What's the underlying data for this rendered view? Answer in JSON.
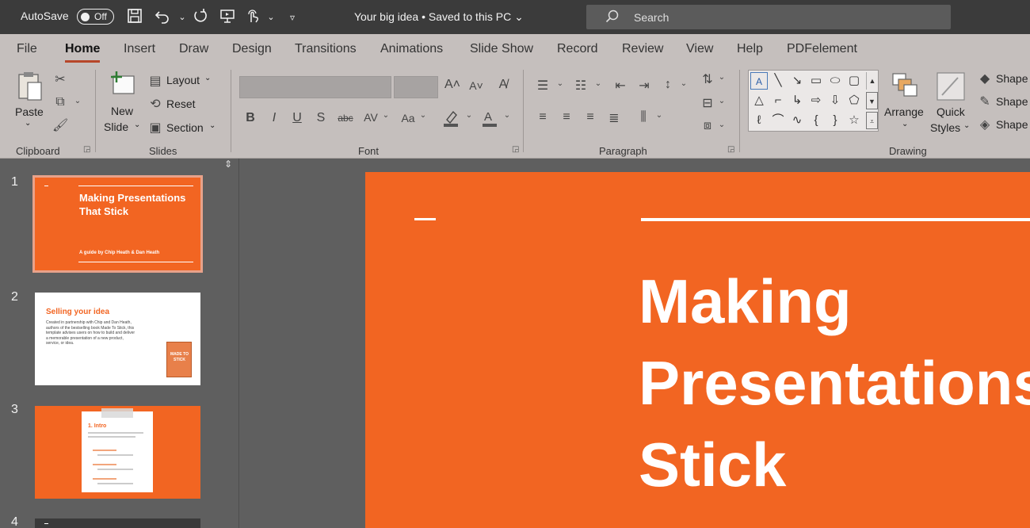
{
  "titlebar": {
    "autosave_label": "AutoSave",
    "autosave_state": "Off",
    "doc_title": "Your big idea • Saved to this PC",
    "search_placeholder": "Search",
    "icons": [
      "save-icon",
      "undo-icon",
      "redo-icon",
      "present-icon",
      "touch-mode-icon",
      "customize-toolbar-icon"
    ]
  },
  "tabs": [
    {
      "label": "File"
    },
    {
      "label": "Home",
      "active": true
    },
    {
      "label": "Insert"
    },
    {
      "label": "Draw"
    },
    {
      "label": "Design"
    },
    {
      "label": "Transitions"
    },
    {
      "label": "Animations"
    },
    {
      "label": "Slide Show"
    },
    {
      "label": "Record"
    },
    {
      "label": "Review"
    },
    {
      "label": "View"
    },
    {
      "label": "Help"
    },
    {
      "label": "PDFelement"
    }
  ],
  "ribbon": {
    "clipboard": {
      "paste": "Paste",
      "group": "Clipboard"
    },
    "slides": {
      "new_slide_1": "New",
      "new_slide_2": "Slide",
      "layout": "Layout",
      "reset": "Reset",
      "section": "Section",
      "group": "Slides"
    },
    "font": {
      "group": "Font",
      "bold": "B",
      "italic": "I",
      "underline": "U",
      "shadow": "S",
      "strike": "abc",
      "spacing": "AV",
      "case": "Aa"
    },
    "paragraph": {
      "group": "Paragraph"
    },
    "drawing": {
      "arrange": "Arrange",
      "quick_styles_1": "Quick",
      "quick_styles_2": "Styles",
      "shape_fill": "Shape",
      "shape_outline": "Shape",
      "shape_effects": "Shape",
      "group": "Drawing"
    }
  },
  "thumbnails": [
    {
      "number": "1",
      "title": "Making Presentations That Stick",
      "subtitle": "A guide by Chip Heath & Dan Heath"
    },
    {
      "number": "2",
      "title": "Selling your idea",
      "body": "Created in partnership with Chip and Dan Heath, authors of the bestselling book Made To Stick, this template advises users on how to build and deliver a memorable presentation of a new product, service, or idea.",
      "book_label": "MADE TO STICK"
    },
    {
      "number": "3",
      "title": "1. Intro"
    },
    {
      "number": "4"
    }
  ],
  "slide": {
    "title_lines": [
      "Making",
      "Presentations",
      "Stick"
    ]
  },
  "colors": {
    "accent": "#f26522",
    "tab_underline": "#b7472a",
    "titlebar": "#3b3b3b",
    "ribbon": "#c5bfbd"
  }
}
